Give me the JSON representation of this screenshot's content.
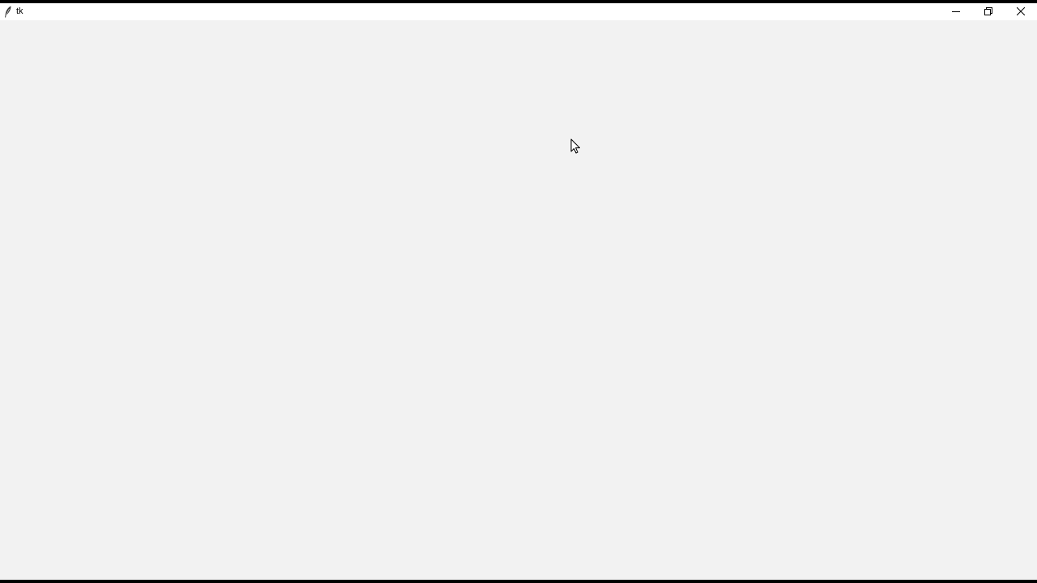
{
  "window": {
    "title": "tk",
    "app_icon": "tk-feather-icon",
    "controls": {
      "minimize_icon": "minimize-icon",
      "restore_icon": "restore-icon",
      "close_icon": "close-icon"
    }
  },
  "colors": {
    "client_background": "#f2f2f2",
    "titlebar_background": "#ffffff",
    "screen_border": "#000000"
  }
}
